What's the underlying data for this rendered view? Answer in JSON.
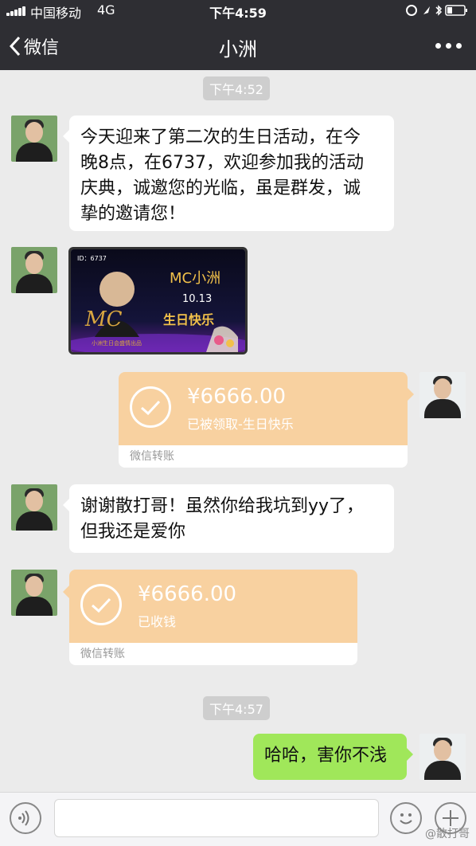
{
  "status_bar": {
    "carrier": "中国移动",
    "network": "4G",
    "time": "下午4:59"
  },
  "nav": {
    "back_label": "微信",
    "title": "小洲"
  },
  "chat": {
    "time_1": "下午4:52",
    "msg_1": {
      "line1": "今天迎来了第二次的生日活动，在今",
      "line2": "晚8点，在6737，欢迎参加我的活动",
      "line3": "庆典，诚邀您的光临，虽是群发，诚",
      "line4": "挚的邀请您！"
    },
    "poster": {
      "id_text": "ID：6737",
      "name": "MC小洲",
      "date": "10.13",
      "big_letters": "MC",
      "greeting": "生日快乐",
      "subtitle": "小洲生日会盛情出品"
    },
    "transfer_1": {
      "amount": "¥6666.00",
      "note": "已被领取-生日快乐",
      "footer": "微信转账"
    },
    "msg_2": {
      "line1": "谢谢散打哥！虽然你给我坑到yy了，",
      "line2": "但我还是爱你"
    },
    "transfer_2": {
      "amount": "¥6666.00",
      "note": "已收钱",
      "footer": "微信转账"
    },
    "time_2": "下午4:57",
    "msg_3": "哈哈，害你不浅"
  },
  "watermark": "@散打哥",
  "colors": {
    "nav_bg": "#2e2e33",
    "chat_bg": "#ebebeb",
    "green_bubble": "#a0e75a",
    "transfer_orange": "#f8d1a0"
  }
}
